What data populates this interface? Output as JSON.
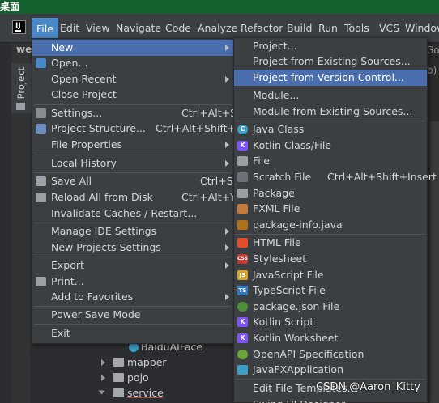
{
  "desktop_title": "桌面",
  "menubar": [
    "File",
    "Edit",
    "View",
    "Navigate",
    "Code",
    "Analyze",
    "Refactor",
    "Build",
    "Run",
    "Tools",
    "VCS",
    "Window"
  ],
  "side_tab": "Project",
  "project_label": "we",
  "editor_snippets": [
    "Go",
    "b)"
  ],
  "file_menu": [
    {
      "label": "New",
      "icon": "none",
      "submenu": true,
      "highlighted": true
    },
    {
      "label": "Open...",
      "icon": "folder-icon"
    },
    {
      "label": "Open Recent",
      "submenu": true
    },
    {
      "label": "Close Project"
    },
    {
      "label": "Settings...",
      "shortcut": "Ctrl+Alt+S",
      "icon": "wrench-icon"
    },
    {
      "label": "Project Structure...",
      "shortcut": "Ctrl+Alt+Shift+S",
      "icon": "project-structure-icon"
    },
    {
      "label": "File Properties",
      "submenu": true
    },
    {
      "label": "Local History",
      "submenu": true
    },
    {
      "label": "Save All",
      "shortcut": "Ctrl+S",
      "icon": "save-icon"
    },
    {
      "label": "Reload All from Disk",
      "shortcut": "Ctrl+Alt+Y",
      "icon": "reload-icon"
    },
    {
      "label": "Invalidate Caches / Restart..."
    },
    {
      "label": "Manage IDE Settings",
      "submenu": true
    },
    {
      "label": "New Projects Settings",
      "submenu": true
    },
    {
      "label": "Export",
      "submenu": true
    },
    {
      "label": "Print...",
      "icon": "print-icon"
    },
    {
      "label": "Add to Favorites",
      "submenu": true
    },
    {
      "label": "Power Save Mode"
    },
    {
      "label": "Exit"
    }
  ],
  "new_menu": [
    {
      "label": "Project..."
    },
    {
      "label": "Project from Existing Sources..."
    },
    {
      "label": "Project from Version Control...",
      "highlighted": true
    },
    {
      "label": "Module..."
    },
    {
      "label": "Module from Existing Sources..."
    },
    {
      "label": "Java Class",
      "icon": "java-class-icon"
    },
    {
      "label": "Kotlin Class/File",
      "icon": "kotlin-icon"
    },
    {
      "label": "File",
      "icon": "file-icon"
    },
    {
      "label": "Scratch File",
      "shortcut": "Ctrl+Alt+Shift+Insert",
      "icon": "scratch-file-icon"
    },
    {
      "label": "Package",
      "icon": "package-icon"
    },
    {
      "label": "FXML File",
      "icon": "fxml-icon"
    },
    {
      "label": "package-info.java",
      "icon": "package-info-icon"
    },
    {
      "label": "HTML File",
      "icon": "html-icon"
    },
    {
      "label": "Stylesheet",
      "icon": "css-icon"
    },
    {
      "label": "JavaScript File",
      "icon": "js-icon"
    },
    {
      "label": "TypeScript File",
      "icon": "ts-icon"
    },
    {
      "label": "package.json File",
      "icon": "package-json-icon"
    },
    {
      "label": "Kotlin Script",
      "icon": "kotlin-script-icon"
    },
    {
      "label": "Kotlin Worksheet",
      "icon": "kotlin-worksheet-icon"
    },
    {
      "label": "OpenAPI Specification",
      "icon": "openapi-icon"
    },
    {
      "label": "JavaFXApplication",
      "icon": "javafx-icon"
    },
    {
      "label": "Edit File Templates..."
    },
    {
      "label": "Swing UI Designer"
    }
  ],
  "tree": [
    {
      "label": "BaiduAIFace",
      "icon": "class-icon"
    },
    {
      "label": "mapper",
      "icon": "folder-icon"
    },
    {
      "label": "pojo",
      "icon": "folder-icon"
    },
    {
      "label": "service",
      "icon": "folder-icon"
    }
  ],
  "watermark": "CSDN @Aaron_Kitty"
}
